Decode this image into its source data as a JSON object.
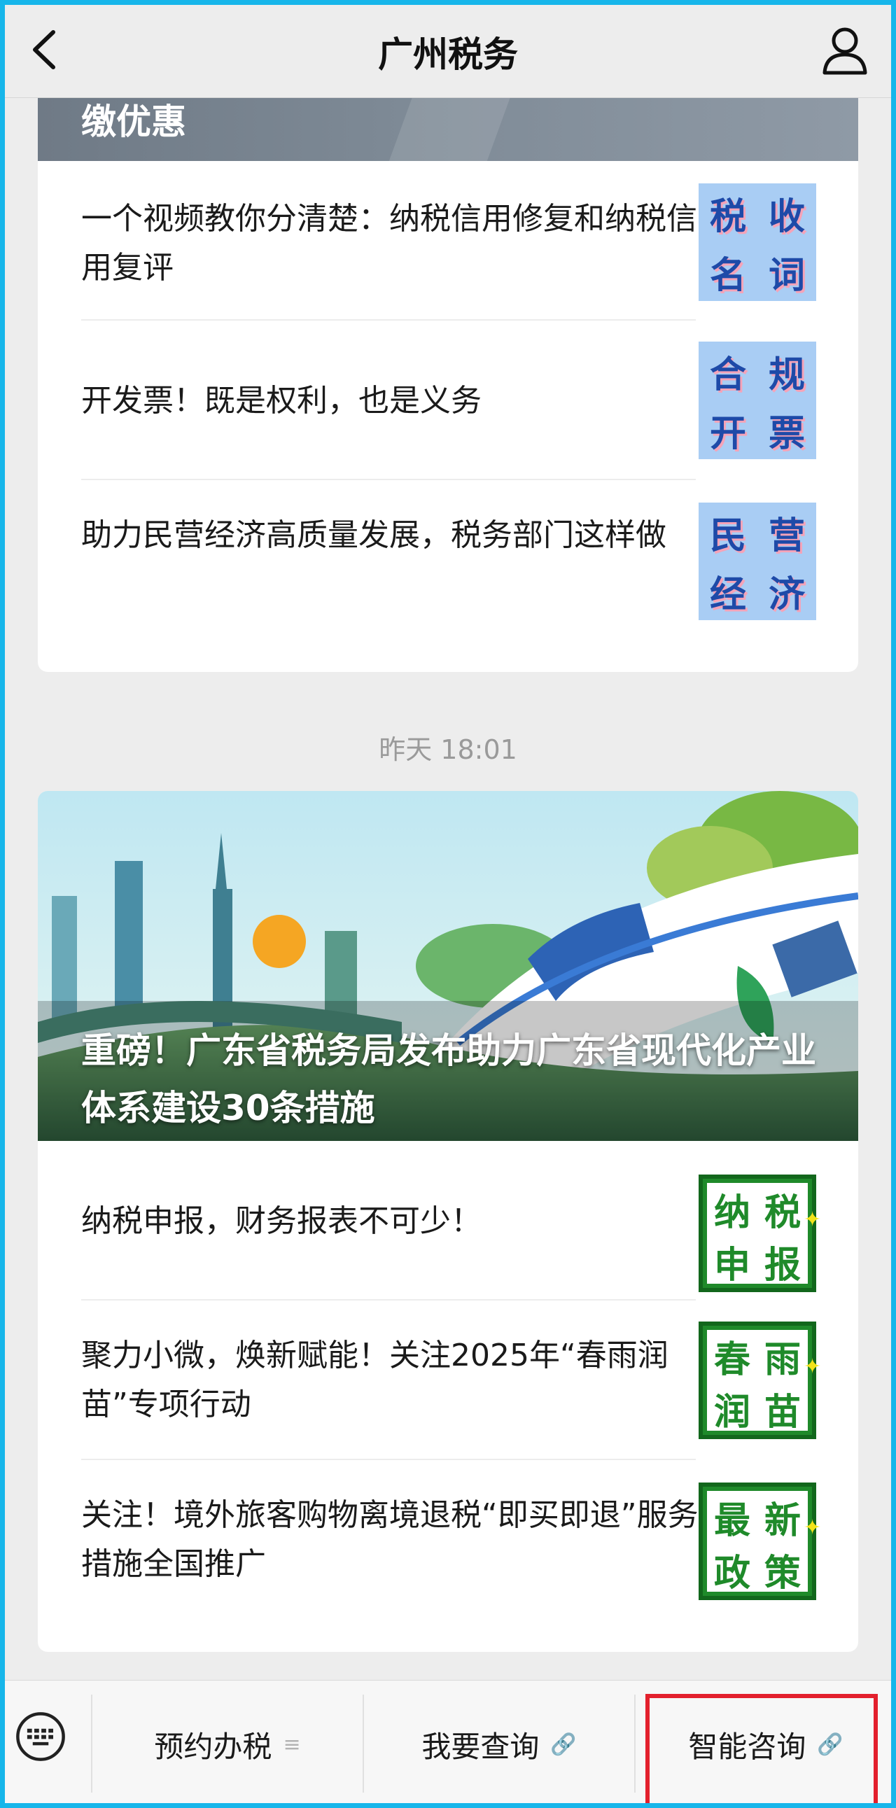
{
  "nav": {
    "title": "广州税务"
  },
  "card1": {
    "banner_text": "缴优惠",
    "items": [
      {
        "text": "一个视频教你分清楚：纳税信用修复和纳税信用复评",
        "thumb": [
          "税",
          "收",
          "名",
          "词"
        ]
      },
      {
        "text": "开发票！既是权利，也是义务",
        "thumb": [
          "合",
          "规",
          "开",
          "票"
        ]
      },
      {
        "text": "助力民营经济高质量发展，税务部门这样做",
        "thumb": [
          "民",
          "营",
          "经",
          "济"
        ]
      }
    ]
  },
  "timestamp": "昨天 18:01",
  "card2": {
    "hero_title": "重磅！广东省税务局发布助力广东省现代化产业体系建设30条措施",
    "items": [
      {
        "text": "纳税申报，财务报表不可少！",
        "thumb": [
          "纳",
          "税",
          "申",
          "报"
        ]
      },
      {
        "text": "聚力小微，焕新赋能！关注2025年“春雨润苗”专项行动",
        "thumb": [
          "春",
          "雨",
          "润",
          "苗"
        ]
      },
      {
        "text": "关注！境外旅客购物离境退税“即买即退”服务措施全国推广",
        "thumb": [
          "最",
          "新",
          "政",
          "策"
        ]
      }
    ]
  },
  "menu": {
    "items": [
      {
        "label": "预约办税",
        "suffix": "≡"
      },
      {
        "label": "我要查询",
        "suffix": "🔗"
      },
      {
        "label": "智能咨询",
        "suffix": "🔗"
      }
    ]
  },
  "colors": {
    "accent_border": "#17b6ea",
    "highlight": "#e3202d",
    "thumb_blue": "#a9cdf4",
    "thumb_green": "#1f8a2a"
  }
}
